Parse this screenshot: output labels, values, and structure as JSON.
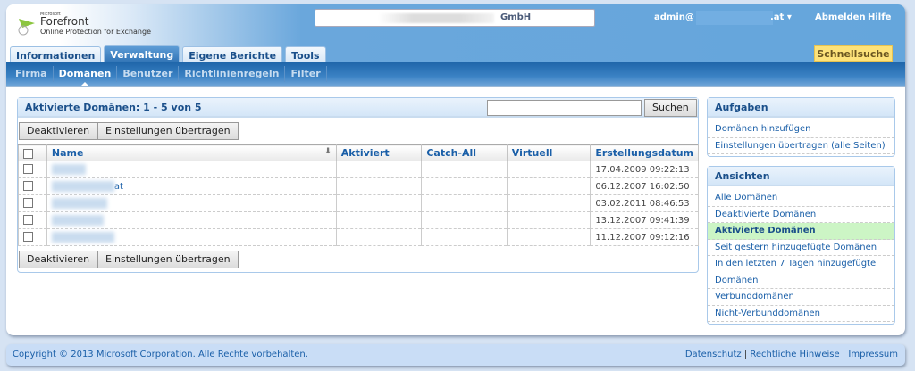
{
  "header": {
    "logo_small": "Microsoft",
    "logo_brand": "Forefront",
    "logo_product": "Online Protection for Exchange",
    "company_suffix": "GmbH",
    "user_prefix": "admin@",
    "user_suffix": ".at",
    "logout": "Abmelden",
    "help": "Hilfe",
    "quick_search": "Schnellsuche"
  },
  "tabs": [
    "Informationen",
    "Verwaltung",
    "Eigene Berichte",
    "Tools"
  ],
  "subnav": [
    "Firma",
    "Domänen",
    "Benutzer",
    "Richtlinienregeln",
    "Filter"
  ],
  "main": {
    "title": "Aktivierte Domänen: 1 - 5 von 5",
    "search_value": "",
    "search_button": "Suchen",
    "deactivate": "Deaktivieren",
    "transfer": "Einstellungen übertragen",
    "columns": [
      "Name",
      "Aktiviert",
      "Catch-All",
      "Virtuell",
      "Erstellungsdatum"
    ],
    "rows": [
      {
        "name_suffix": "",
        "date": "17.04.2009 09:22:13"
      },
      {
        "name_suffix": "at",
        "date": "06.12.2007 16:02:50"
      },
      {
        "name_suffix": "",
        "date": "03.02.2011 08:46:53"
      },
      {
        "name_suffix": "",
        "date": "13.12.2007 09:41:39"
      },
      {
        "name_suffix": "",
        "date": "11.12.2007 09:12:16"
      }
    ]
  },
  "tasks": {
    "title": "Aufgaben",
    "items": [
      "Domänen hinzufügen",
      "Einstellungen übertragen (alle Seiten)"
    ]
  },
  "views": {
    "title": "Ansichten",
    "items": [
      "Alle Domänen",
      "Deaktivierte Domänen",
      "Aktivierte Domänen",
      "Seit gestern hinzugefügte Domänen",
      "In den letzten 7 Tagen hinzugefügte",
      "Domänen",
      "Verbunddomänen",
      "Nicht-Verbunddomänen"
    ]
  },
  "footer": {
    "copyright": "Copyright © 2013 Microsoft Corporation. Alle Rechte vorbehalten.",
    "links": [
      "Datenschutz",
      "Rechtliche Hinweise",
      "Impressum"
    ],
    "sep": "|"
  }
}
